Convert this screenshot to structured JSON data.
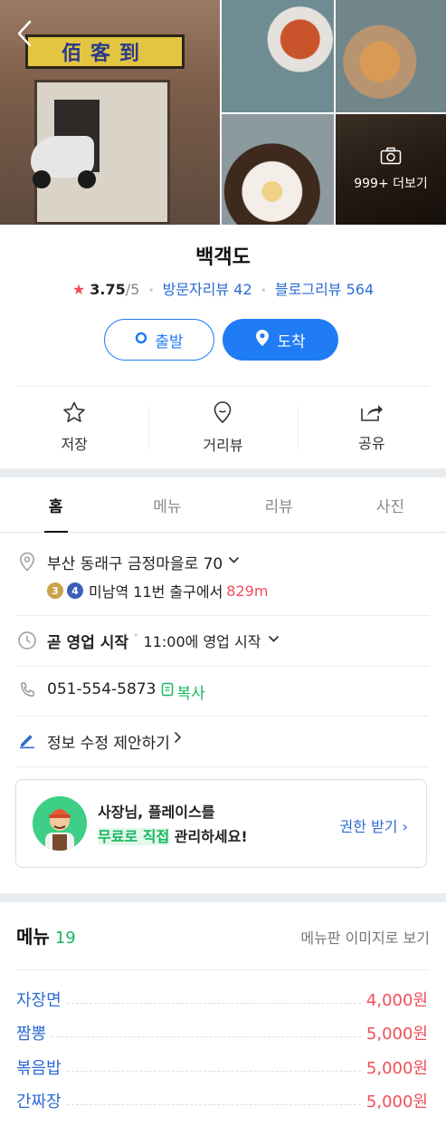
{
  "header": {
    "more_photos_label": "999+ 더보기",
    "sign_text": "佰客到"
  },
  "place": {
    "name": "백객도",
    "rating": "3.75",
    "rating_max": "/5",
    "visitor_reviews_label": "방문자리뷰 42",
    "blog_reviews_label": "블로그리뷰 564"
  },
  "route": {
    "depart_label": "출발",
    "arrive_label": "도착"
  },
  "actions": [
    {
      "label": "저장",
      "icon": "star-icon"
    },
    {
      "label": "거리뷰",
      "icon": "location-pin-icon"
    },
    {
      "label": "공유",
      "icon": "share-icon"
    }
  ],
  "tabs": [
    {
      "label": "홈",
      "active": true
    },
    {
      "label": "메뉴",
      "active": false
    },
    {
      "label": "리뷰",
      "active": false
    },
    {
      "label": "사진",
      "active": false
    }
  ],
  "info": {
    "address": "부산 동래구 금정마을로 70",
    "transit_line1": "3",
    "transit_line2": "4",
    "transit_line1_color": "#c9a24a",
    "transit_line2_color": "#3d5fb8",
    "station_text": "미남역 11번 출구에서",
    "distance": "829m",
    "hours_status": "곧 영업 시작",
    "hours_detail": "11:00에 영업 시작",
    "phone": "051-554-5873",
    "copy_label": "복사",
    "suggest_edit": "정보 수정 제안하기"
  },
  "owner_card": {
    "line1": "사장님, 플레이스를",
    "line2_highlight": "무료로 직접",
    "line2_rest": " 관리하세요!",
    "link": "권한 받기 ›"
  },
  "menu": {
    "title": "메뉴",
    "count": "19",
    "view_image_label": "메뉴판 이미지로 보기",
    "items": [
      {
        "name": "자장면",
        "price": "4,000원"
      },
      {
        "name": "짬뽕",
        "price": "5,000원"
      },
      {
        "name": "볶음밥",
        "price": "5,000원"
      },
      {
        "name": "간짜장",
        "price": "5,000원"
      }
    ]
  },
  "colors": {
    "accent_blue": "#1f7cf5",
    "link_blue": "#2d6bd3",
    "price_red": "#f04e58",
    "green": "#17b75e"
  }
}
